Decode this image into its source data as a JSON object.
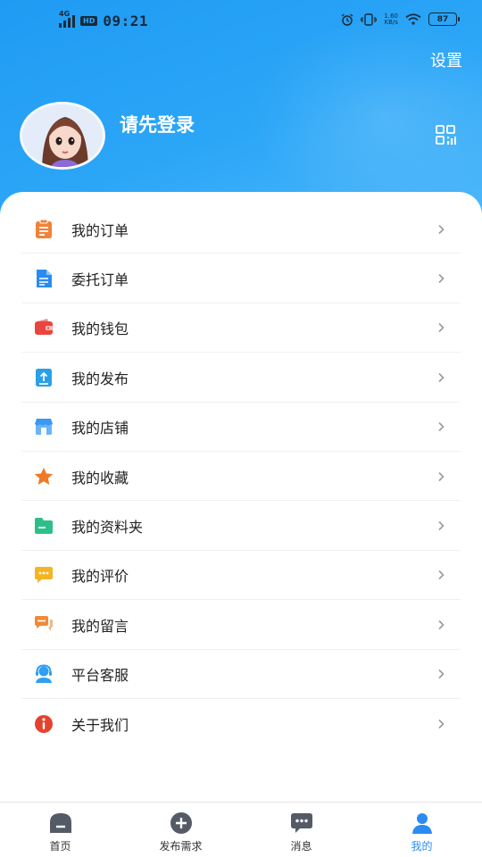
{
  "status_bar": {
    "network": "4G",
    "hd": "HD",
    "time": "09:21",
    "speed_value": "1.60",
    "speed_unit": "KB/s",
    "battery": "87"
  },
  "header": {
    "settings_label": "设置",
    "login_prompt": "请先登录"
  },
  "menu": {
    "items": [
      {
        "label": "我的订单",
        "icon": "clipboard-icon",
        "color": "#f0823a"
      },
      {
        "label": "委托订单",
        "icon": "document-icon",
        "color": "#2a8cf0"
      },
      {
        "label": "我的钱包",
        "icon": "wallet-icon",
        "color": "#e9453f"
      },
      {
        "label": "我的发布",
        "icon": "upload-icon",
        "color": "#2aa0e8"
      },
      {
        "label": "我的店铺",
        "icon": "store-icon",
        "color": "#3a98f2"
      },
      {
        "label": "我的收藏",
        "icon": "star-icon",
        "color": "#f07a28"
      },
      {
        "label": "我的资料夹",
        "icon": "folder-icon",
        "color": "#2dbf8a"
      },
      {
        "label": "我的评价",
        "icon": "comment-icon",
        "color": "#f5b423"
      },
      {
        "label": "我的留言",
        "icon": "message-icon",
        "color": "#f08a3a"
      },
      {
        "label": "平台客服",
        "icon": "headset-icon",
        "color": "#2e9ff2"
      },
      {
        "label": "关于我们",
        "icon": "info-icon",
        "color": "#e5422e"
      }
    ]
  },
  "tabbar": {
    "tabs": [
      {
        "label": "首页",
        "icon": "home-icon"
      },
      {
        "label": "发布需求",
        "icon": "plus-circle-icon"
      },
      {
        "label": "消息",
        "icon": "chat-bubble-icon"
      },
      {
        "label": "我的",
        "icon": "profile-icon"
      }
    ],
    "active_color": "#2a8cf0"
  },
  "colors": {
    "header_gradient_start": "#1f9bf3",
    "header_gradient_end": "#4fb8fb"
  }
}
